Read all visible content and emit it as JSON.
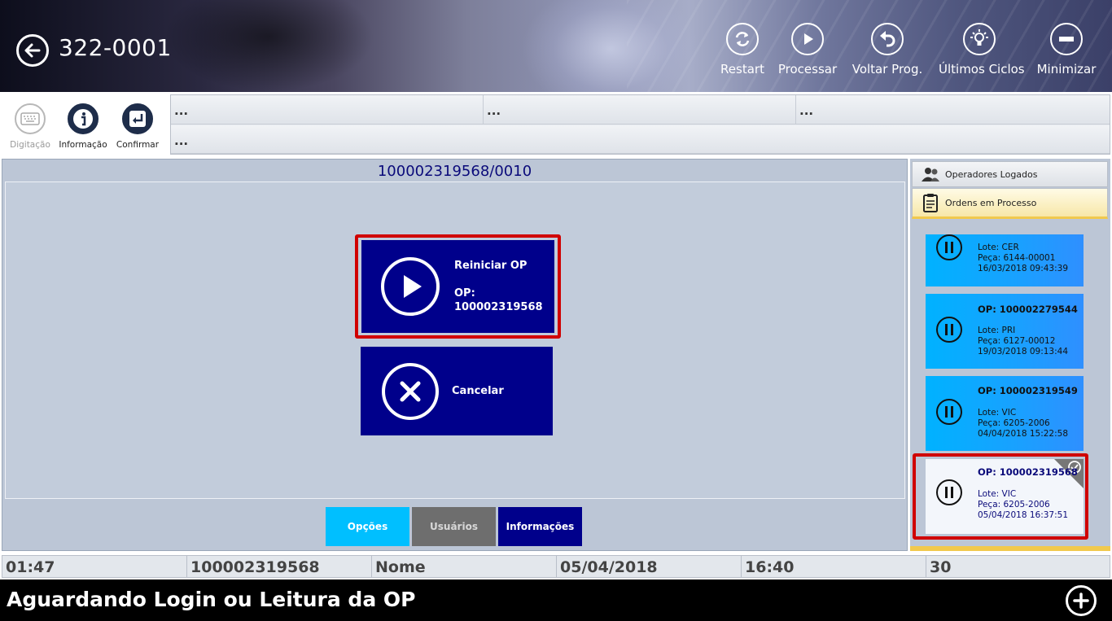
{
  "header": {
    "machine_id": "322-0001",
    "actions": [
      {
        "label": "Restart",
        "icon": "restart-icon"
      },
      {
        "label": "Processar",
        "icon": "play-icon"
      },
      {
        "label": "Voltar Prog.",
        "icon": "undo-icon"
      },
      {
        "label": "Últimos Ciclos",
        "icon": "lightbulb-icon"
      },
      {
        "label": "Minimizar",
        "icon": "minus-icon"
      }
    ]
  },
  "toolbar": {
    "tools": [
      {
        "label": "Digitação",
        "icon": "keyboard-icon",
        "enabled": false
      },
      {
        "label": "Informação",
        "icon": "info-icon",
        "enabled": true
      },
      {
        "label": "Confirmar",
        "icon": "enter-icon",
        "enabled": true
      }
    ],
    "info_cells": [
      "...",
      "...",
      "...",
      "..."
    ]
  },
  "main": {
    "op_title": "100002319568/0010",
    "restart": {
      "label": "Reiniciar OP",
      "op_label": "OP:",
      "op_number": "100002319568"
    },
    "cancel": {
      "label": "Cancelar"
    },
    "tabs": [
      {
        "label": "Opções",
        "color": "#00bfff"
      },
      {
        "label": "Usuários",
        "color": "#6e6e6e"
      },
      {
        "label": "Informações",
        "color": "#00008b"
      }
    ]
  },
  "side": {
    "tab_operators": "Operadores Logados",
    "tab_orders": "Ordens em Processo",
    "orders": [
      {
        "op": "",
        "lote": "Lote: CER",
        "peca": "Peça: 6144-00001",
        "data": "16/03/2018 09:43:39"
      },
      {
        "op": "OP: 100002279544",
        "lote": "Lote: PRI",
        "peca": "Peça: 6127-00012",
        "data": "19/03/2018 09:13:44"
      },
      {
        "op": "OP: 100002319549",
        "lote": "Lote: VIC",
        "peca": "Peça: 6205-2006",
        "data": "04/04/2018 15:22:58"
      },
      {
        "op": "OP: 100002319568",
        "lote": "Lote: VIC",
        "peca": "Peça: 6205-2006",
        "data": "05/04/2018 16:37:51",
        "selected": true
      }
    ]
  },
  "status": {
    "cells": [
      "01:47",
      "100002319568",
      "Nome",
      "05/04/2018",
      "16:40",
      "30"
    ]
  },
  "footer": {
    "message": "Aguardando Login ou Leitura da OP"
  },
  "colors": {
    "accent_blue": "#00008b",
    "highlight_red": "#d00000",
    "card_cyan": "#00b2ff"
  }
}
